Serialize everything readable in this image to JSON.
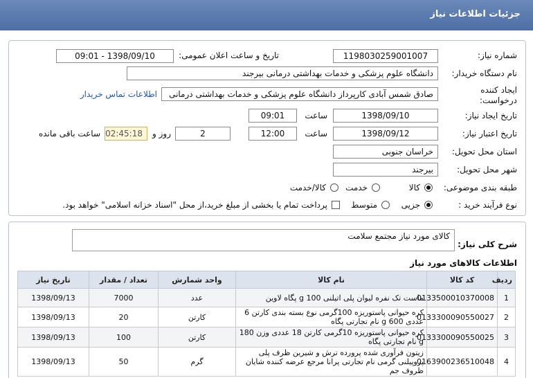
{
  "header": {
    "title": "جزئیات اطلاعات نیاز"
  },
  "form": {
    "need_number": {
      "label": "شماره نیاز:",
      "value": "1198030259001007"
    },
    "announce": {
      "label": "تاریخ و ساعت اعلان عمومی:",
      "value": "1398/09/10 - 09:01"
    },
    "buyer": {
      "label": "نام دستگاه خریدار:",
      "value": "دانشگاه علوم پزشکی و خدمات بهداشتی درمانی بیرجند"
    },
    "creator": {
      "label1": "ایجاد کننده",
      "label2": "درخواست:",
      "value": "صادق شمس آبادی کارپرداز دانشگاه علوم پزشکی و خدمات بهداشتی درمانی",
      "contact_link": "اطلاعات تماس خریدار"
    },
    "created": {
      "label": "تاریخ ایجاد نیاز:",
      "date": "1398/09/10",
      "time_label": "ساعت",
      "time": "09:01"
    },
    "validity": {
      "label": "تاریخ اعتبار نیاز:",
      "date": "1398/09/12",
      "time_label": "ساعت",
      "time": "12:00",
      "days": "2",
      "days_label": "روز و",
      "remaining": "02:45:18",
      "remaining_label": "ساعت باقی مانده"
    },
    "province": {
      "label": "استان محل تحویل:",
      "value": "خراسان جنوبی"
    },
    "city": {
      "label": "شهر محل تحویل:",
      "value": "بیرجند"
    },
    "category": {
      "label": "طبقه بندی موضوعی:",
      "options": [
        "کالا",
        "خدمت",
        "کالا/خدمت"
      ],
      "selected": "کالا"
    },
    "purchase": {
      "label": "نوع فرآیند خرید :",
      "options": [
        "جزیی",
        "متوسط"
      ],
      "selected": "جزیی",
      "checkbox_label": "پرداخت تمام یا بخشی از مبلغ خرید،از محل \"اسناد خزانه اسلامی\" خواهد بود."
    }
  },
  "description": {
    "label": "شرح کلی نیاز:",
    "value": "کالای مورد نیاز مجتمع سلامت"
  },
  "items": {
    "title": "اطلاعات کالاهای مورد نیاز",
    "columns": [
      "ردیف",
      "کد کالا",
      "نام کالا",
      "واحد شمارش",
      "تعداد / مقدار",
      "تاریخ نیاز"
    ],
    "rows": [
      {
        "row": "1",
        "code": "0133500010370008",
        "name": "ماست تک نفره لیوان پلی اتیلنی 100 g پگاه لاوین",
        "unit": "عدد",
        "qty": "7000",
        "date": "1398/09/13"
      },
      {
        "row": "2",
        "code": "0133300090550027",
        "name": "کره حیوانی پاستوریزه 100گرمی نوع بسته بندی کارتن 6 عددی 600 g نام تجارتی پگاه",
        "unit": "کارتن",
        "qty": "20",
        "date": "1398/09/13"
      },
      {
        "row": "3",
        "code": "0133300090550025",
        "name": "کره حیوانی پاستوریزه 10گرمی کارتن 18 عددی وزن 180 g نام تجارتی پگاه",
        "unit": "کارتن",
        "qty": "100",
        "date": "1398/09/13"
      },
      {
        "row": "4",
        "code": "0163900236510048",
        "name": "زیتون فرآوری شده پرورده ترش و شیرین ظرف پلی پروپیلنی گرمی نام تجارتی پرانا مرجع عرضه کننده شایان ظروف جم",
        "unit": "گرم",
        "qty": "50",
        "date": "1398/09/13"
      }
    ]
  }
}
